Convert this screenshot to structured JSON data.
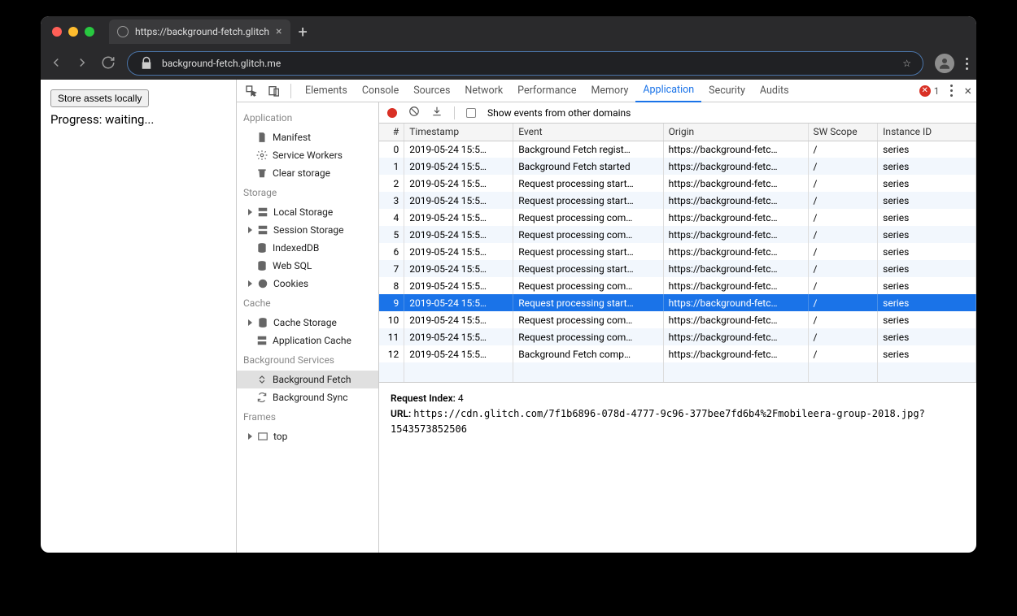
{
  "browser": {
    "tab_title": "https://background-fetch.glitch",
    "url": "background-fetch.glitch.me"
  },
  "page": {
    "button_label": "Store assets locally",
    "progress_text": "Progress: waiting..."
  },
  "devtools": {
    "tabs": [
      "Elements",
      "Console",
      "Sources",
      "Network",
      "Performance",
      "Memory",
      "Application",
      "Security",
      "Audits"
    ],
    "active_tab": "Application",
    "error_count": "1",
    "sidebar": {
      "application": {
        "head": "Application",
        "items": [
          "Manifest",
          "Service Workers",
          "Clear storage"
        ]
      },
      "storage": {
        "head": "Storage",
        "items": [
          "Local Storage",
          "Session Storage",
          "IndexedDB",
          "Web SQL",
          "Cookies"
        ]
      },
      "cache": {
        "head": "Cache",
        "items": [
          "Cache Storage",
          "Application Cache"
        ]
      },
      "bg": {
        "head": "Background Services",
        "items": [
          "Background Fetch",
          "Background Sync"
        ],
        "selected": "Background Fetch"
      },
      "frames": {
        "head": "Frames",
        "items": [
          "top"
        ]
      }
    },
    "toolbar": {
      "checkbox_label": "Show events from other domains"
    },
    "table": {
      "headers": [
        "#",
        "Timestamp",
        "Event",
        "Origin",
        "SW Scope",
        "Instance ID"
      ],
      "rows": [
        {
          "i": "0",
          "ts": "2019-05-24 15:5…",
          "ev": "Background Fetch regist…",
          "or": "https://background-fetc…",
          "sw": "/",
          "id": "series"
        },
        {
          "i": "1",
          "ts": "2019-05-24 15:5…",
          "ev": "Background Fetch started",
          "or": "https://background-fetc…",
          "sw": "/",
          "id": "series"
        },
        {
          "i": "2",
          "ts": "2019-05-24 15:5…",
          "ev": "Request processing start…",
          "or": "https://background-fetc…",
          "sw": "/",
          "id": "series"
        },
        {
          "i": "3",
          "ts": "2019-05-24 15:5…",
          "ev": "Request processing start…",
          "or": "https://background-fetc…",
          "sw": "/",
          "id": "series"
        },
        {
          "i": "4",
          "ts": "2019-05-24 15:5…",
          "ev": "Request processing com…",
          "or": "https://background-fetc…",
          "sw": "/",
          "id": "series"
        },
        {
          "i": "5",
          "ts": "2019-05-24 15:5…",
          "ev": "Request processing com…",
          "or": "https://background-fetc…",
          "sw": "/",
          "id": "series"
        },
        {
          "i": "6",
          "ts": "2019-05-24 15:5…",
          "ev": "Request processing start…",
          "or": "https://background-fetc…",
          "sw": "/",
          "id": "series"
        },
        {
          "i": "7",
          "ts": "2019-05-24 15:5…",
          "ev": "Request processing start…",
          "or": "https://background-fetc…",
          "sw": "/",
          "id": "series"
        },
        {
          "i": "8",
          "ts": "2019-05-24 15:5…",
          "ev": "Request processing com…",
          "or": "https://background-fetc…",
          "sw": "/",
          "id": "series"
        },
        {
          "i": "9",
          "ts": "2019-05-24 15:5…",
          "ev": "Request processing start…",
          "or": "https://background-fetc…",
          "sw": "/",
          "id": "series"
        },
        {
          "i": "10",
          "ts": "2019-05-24 15:5…",
          "ev": "Request processing com…",
          "or": "https://background-fetc…",
          "sw": "/",
          "id": "series"
        },
        {
          "i": "11",
          "ts": "2019-05-24 15:5…",
          "ev": "Request processing com…",
          "or": "https://background-fetc…",
          "sw": "/",
          "id": "series"
        },
        {
          "i": "12",
          "ts": "2019-05-24 15:5…",
          "ev": "Background Fetch comp…",
          "or": "https://background-fetc…",
          "sw": "/",
          "id": "series"
        }
      ],
      "selected_index": 9
    },
    "details": {
      "request_index_label": "Request Index:",
      "request_index": "4",
      "url_label": "URL:",
      "url": "https://cdn.glitch.com/7f1b6896-078d-4777-9c96-377bee7fd6b4%2Fmobileera-group-2018.jpg?1543573852506"
    }
  }
}
